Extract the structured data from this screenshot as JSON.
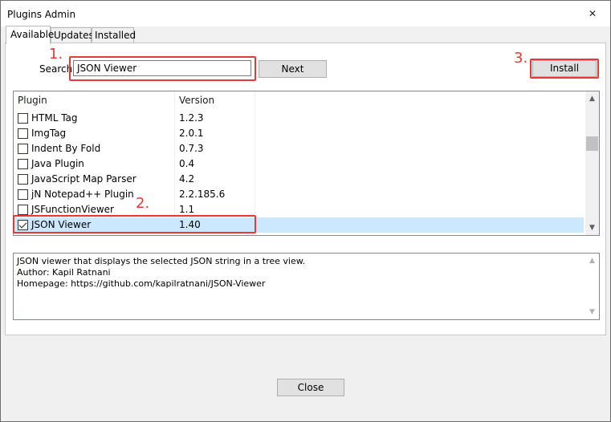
{
  "window": {
    "title": "Plugins Admin",
    "close_glyph": "✕"
  },
  "tabs": [
    {
      "label": "Available",
      "active": true
    },
    {
      "label": "Updates",
      "active": false
    },
    {
      "label": "Installed",
      "active": false
    }
  ],
  "search": {
    "label": "Search",
    "value": "JSON Viewer"
  },
  "buttons": {
    "next": "Next",
    "install": "Install",
    "close": "Close"
  },
  "annotations": {
    "step1": "1.",
    "step2": "2.",
    "step3": "3.",
    "color": "#e53935"
  },
  "plugin_list": {
    "columns": [
      "Plugin",
      "Version"
    ],
    "rows": [
      {
        "name": "HTML Tag",
        "version": "1.2.3",
        "checked": false,
        "selected": false
      },
      {
        "name": "ImgTag",
        "version": "2.0.1",
        "checked": false,
        "selected": false
      },
      {
        "name": "Indent By Fold",
        "version": "0.7.3",
        "checked": false,
        "selected": false
      },
      {
        "name": "Java Plugin",
        "version": "0.4",
        "checked": false,
        "selected": false
      },
      {
        "name": "JavaScript Map Parser",
        "version": "4.2",
        "checked": false,
        "selected": false
      },
      {
        "name": "jN Notepad++ Plugin",
        "version": "2.2.185.6",
        "checked": false,
        "selected": false
      },
      {
        "name": "JSFunctionViewer",
        "version": "1.1",
        "checked": false,
        "selected": false
      },
      {
        "name": "JSON Viewer",
        "version": "1.40",
        "checked": true,
        "selected": true
      }
    ],
    "scroll_up": "▲",
    "scroll_down": "▼"
  },
  "description": {
    "lines": [
      "JSON viewer that displays the selected JSON string in a tree view.",
      "Author: Kapil Ratnani",
      "Homepage: https://github.com/kapilratnani/JSON-Viewer"
    ]
  },
  "colors": {
    "selected_row": "#cce8ff",
    "highlight": "#e53935"
  }
}
